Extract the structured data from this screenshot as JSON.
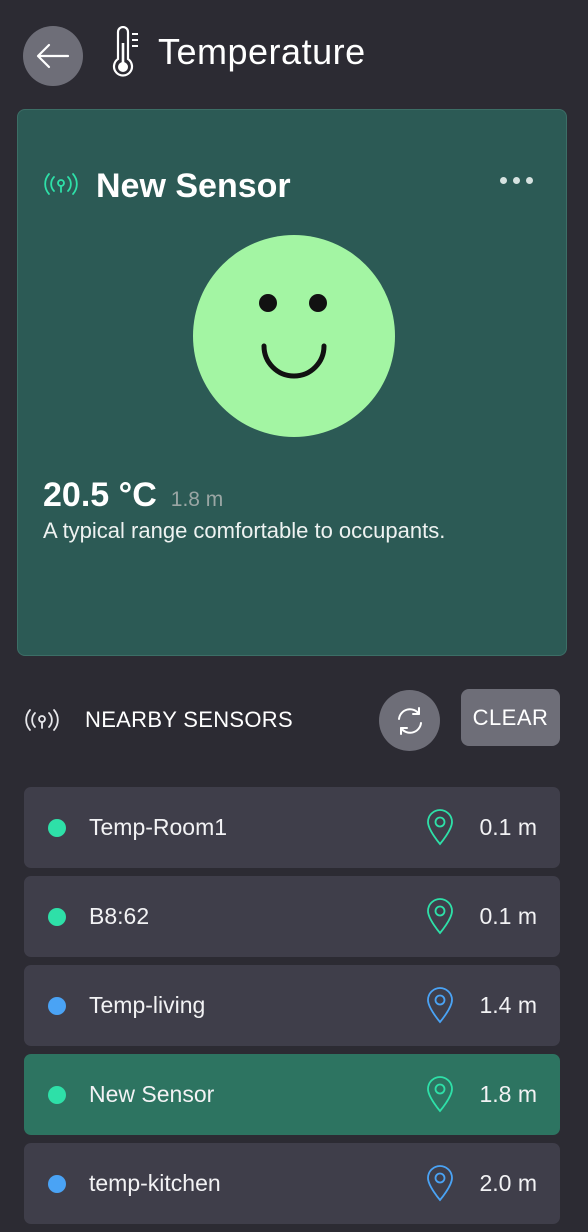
{
  "header": {
    "title": "Temperature",
    "back_icon": "arrow-left-icon",
    "title_icon": "thermometer-icon"
  },
  "selected_sensor": {
    "name": "New Sensor",
    "temperature": "20.5 °C",
    "distance": "1.8 m",
    "description": "A typical range comfortable to occupants.",
    "status_icon": "smiley-face-icon",
    "status_color": "#a3f5a3",
    "card_color": "#2c5a55"
  },
  "nearby": {
    "label": "NEARBY SENSORS",
    "clear_label": "CLEAR",
    "refresh_icon": "refresh-icon"
  },
  "sensors": [
    {
      "name": "Temp-Room1",
      "distance": "0.1 m",
      "color": "#2ee0a8",
      "selected": false
    },
    {
      "name": "B8:62",
      "distance": "0.1 m",
      "color": "#2ee0a8",
      "selected": false
    },
    {
      "name": "Temp-living",
      "distance": "1.4 m",
      "color": "#4aa3f5",
      "selected": false
    },
    {
      "name": "New Sensor",
      "distance": "1.8 m",
      "color": "#2ee0a8",
      "selected": true
    },
    {
      "name": "temp-kitchen",
      "distance": "2.0 m",
      "color": "#4aa3f5",
      "selected": false
    }
  ],
  "colors": {
    "background": "#2c2b33",
    "accent_green": "#2ee0a8",
    "accent_blue": "#4aa3f5",
    "selected_row": "#2d7461"
  }
}
